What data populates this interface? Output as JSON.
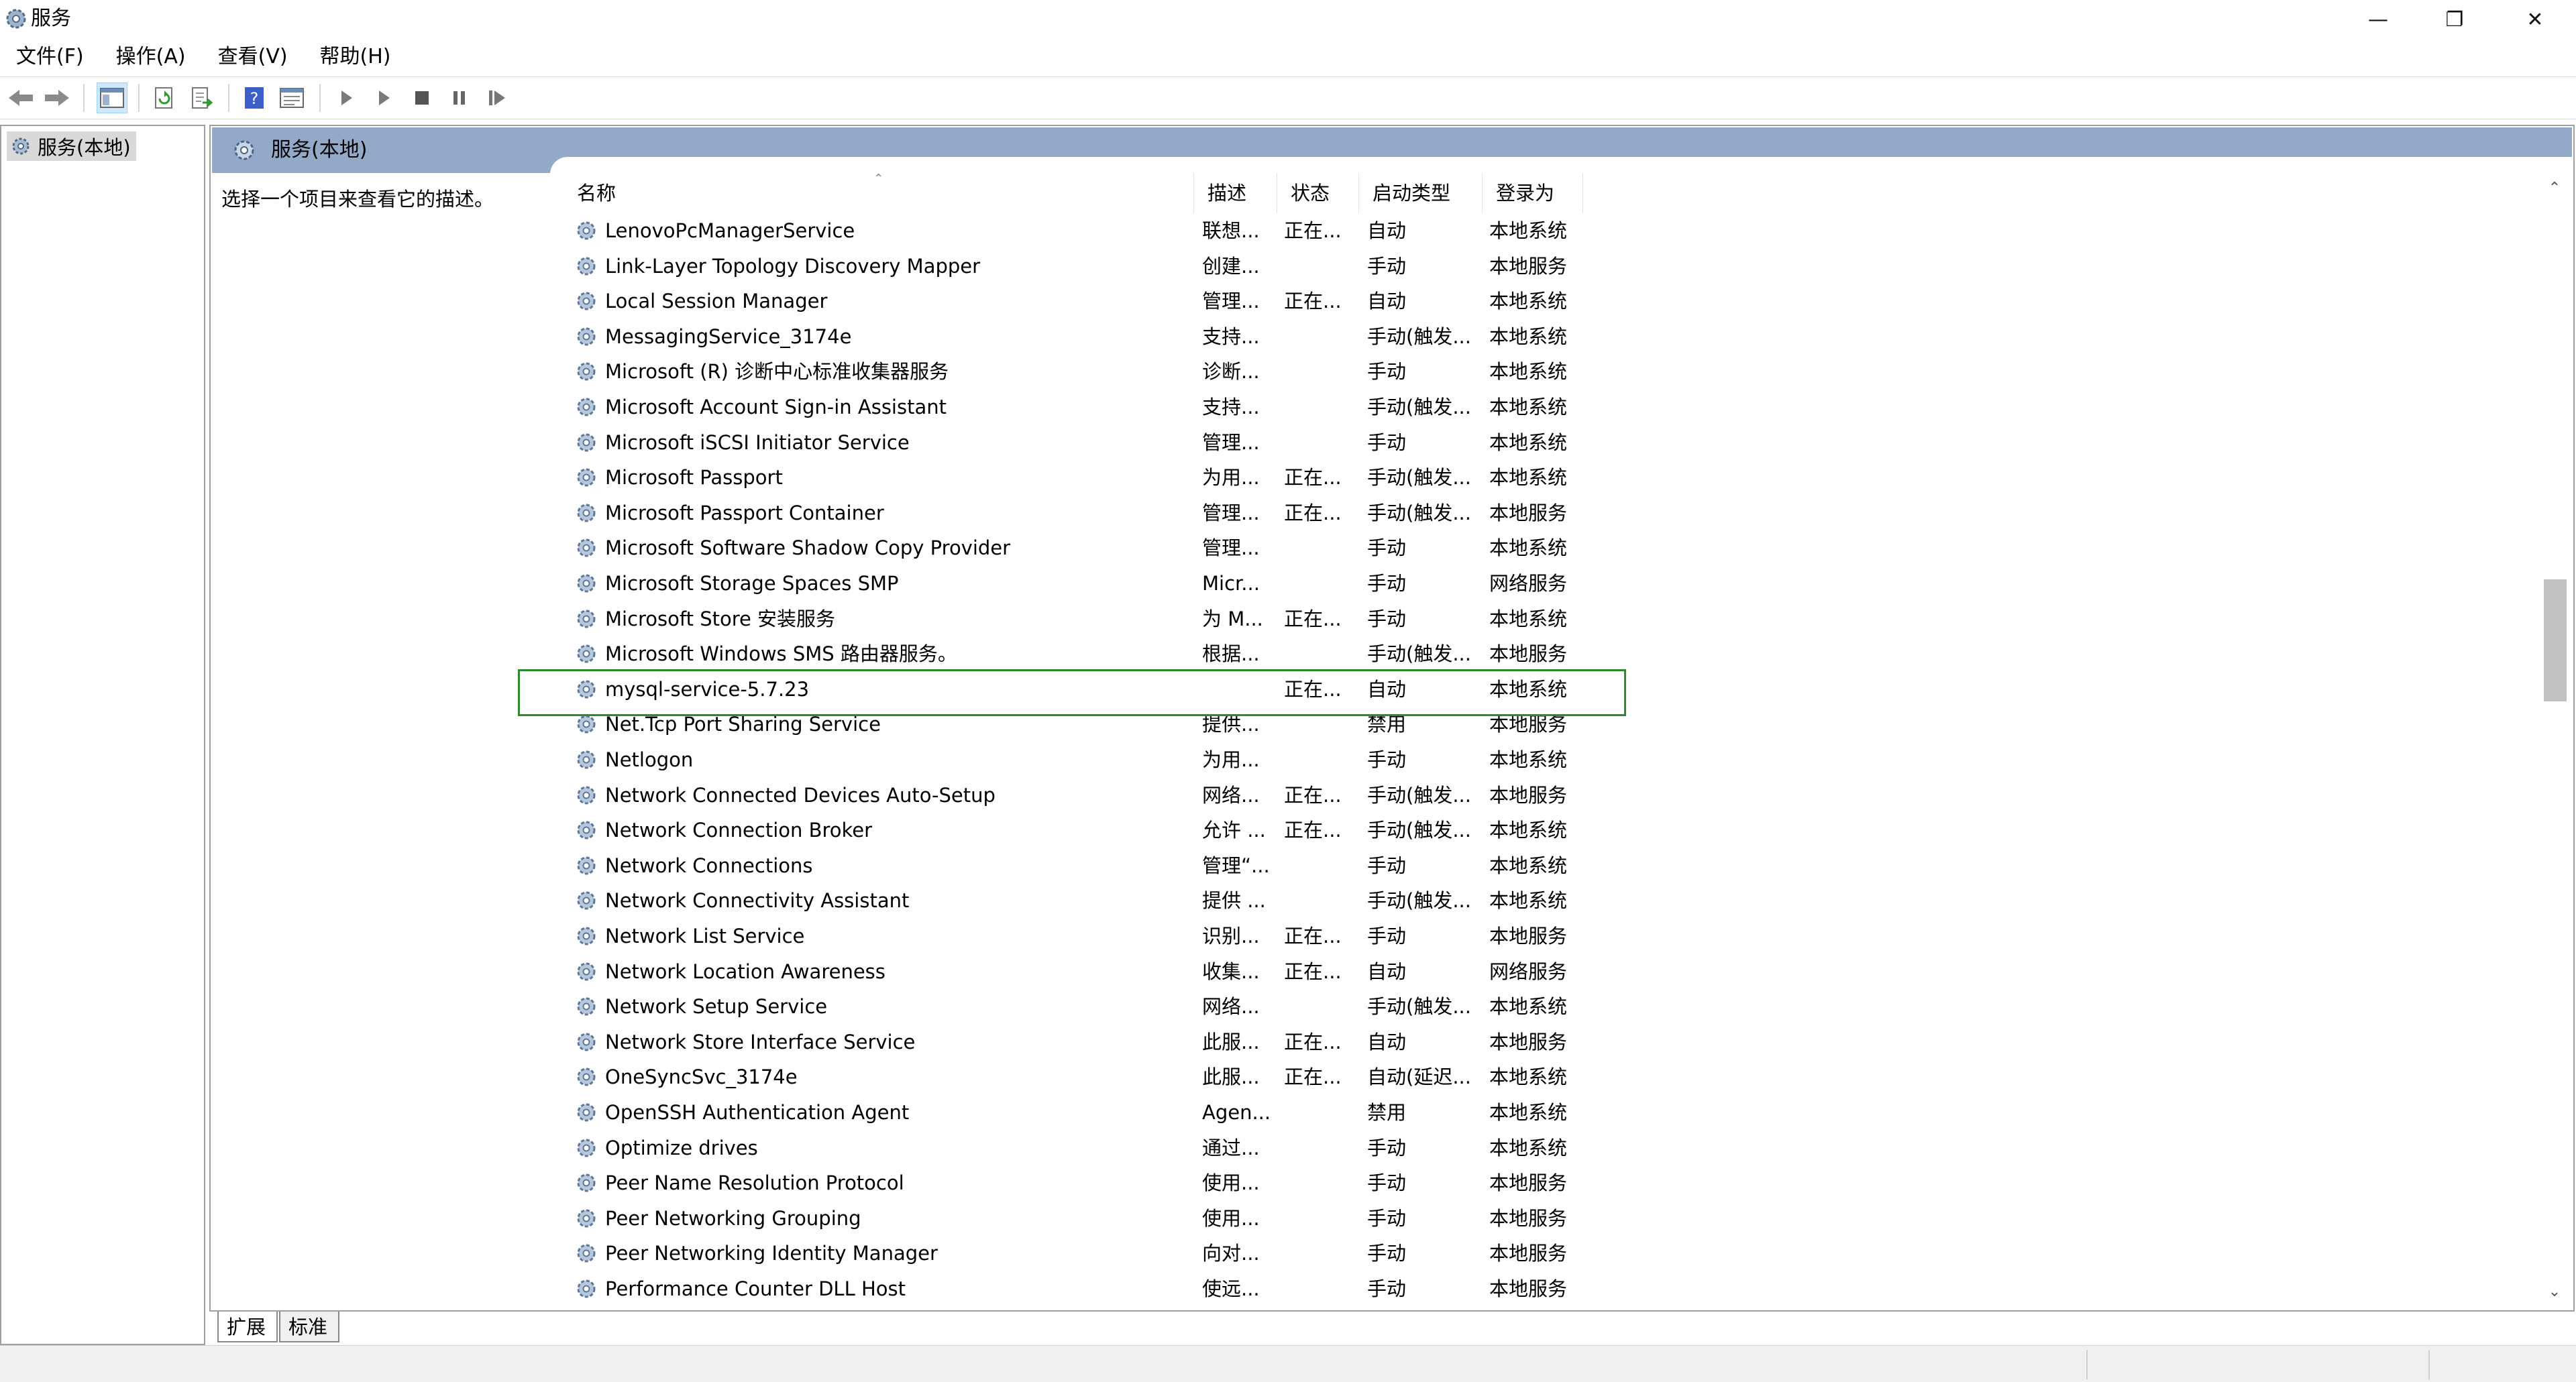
{
  "window": {
    "title": "服务",
    "minimize_icon": "minimize-icon",
    "restore_icon": "restore-icon",
    "close_icon": "close-icon"
  },
  "menu": [
    {
      "label": "文件(F)"
    },
    {
      "label": "操作(A)"
    },
    {
      "label": "查看(V)"
    },
    {
      "label": "帮助(H)"
    }
  ],
  "toolbar": {
    "icons": [
      "back-icon",
      "forward-icon",
      "show-hide-console-tree-icon",
      "refresh-icon",
      "export-list-icon",
      "help-icon",
      "properties-icon",
      "start-service-icon",
      "start-service-alt-icon",
      "stop-service-icon",
      "pause-service-icon",
      "restart-service-icon"
    ]
  },
  "tree": {
    "root_label": "服务(本地)"
  },
  "panel": {
    "header_title": "服务(本地)",
    "description_hint": "选择一个项目来查看它的描述。"
  },
  "columns": {
    "name": "名称",
    "description": "描述",
    "status": "状态",
    "startup_type": "启动类型",
    "logon_as": "登录为"
  },
  "services": [
    {
      "name": "LenovoPcManagerService",
      "description": "联想...",
      "status": "正在...",
      "startup": "自动",
      "logon": "本地系统"
    },
    {
      "name": "Link-Layer Topology Discovery Mapper",
      "description": "创建...",
      "status": "",
      "startup": "手动",
      "logon": "本地服务"
    },
    {
      "name": "Local Session Manager",
      "description": "管理...",
      "status": "正在...",
      "startup": "自动",
      "logon": "本地系统"
    },
    {
      "name": "MessagingService_3174e",
      "description": "支持...",
      "status": "",
      "startup": "手动(触发...",
      "logon": "本地系统"
    },
    {
      "name": "Microsoft (R) 诊断中心标准收集器服务",
      "description": "诊断...",
      "status": "",
      "startup": "手动",
      "logon": "本地系统"
    },
    {
      "name": "Microsoft Account Sign-in Assistant",
      "description": "支持...",
      "status": "",
      "startup": "手动(触发...",
      "logon": "本地系统"
    },
    {
      "name": "Microsoft iSCSI Initiator Service",
      "description": "管理...",
      "status": "",
      "startup": "手动",
      "logon": "本地系统"
    },
    {
      "name": "Microsoft Passport",
      "description": "为用...",
      "status": "正在...",
      "startup": "手动(触发...",
      "logon": "本地系统"
    },
    {
      "name": "Microsoft Passport Container",
      "description": "管理...",
      "status": "正在...",
      "startup": "手动(触发...",
      "logon": "本地服务"
    },
    {
      "name": "Microsoft Software Shadow Copy Provider",
      "description": "管理...",
      "status": "",
      "startup": "手动",
      "logon": "本地系统"
    },
    {
      "name": "Microsoft Storage Spaces SMP",
      "description": "Micr...",
      "status": "",
      "startup": "手动",
      "logon": "网络服务"
    },
    {
      "name": "Microsoft Store 安装服务",
      "description": "为 M...",
      "status": "正在...",
      "startup": "手动",
      "logon": "本地系统"
    },
    {
      "name": "Microsoft Windows SMS 路由器服务。",
      "description": "根据...",
      "status": "",
      "startup": "手动(触发...",
      "logon": "本地服务"
    },
    {
      "name": "mysql-service-5.7.23",
      "description": "",
      "status": "正在...",
      "startup": "自动",
      "logon": "本地系统"
    },
    {
      "name": "Net.Tcp Port Sharing Service",
      "description": "提供...",
      "status": "",
      "startup": "禁用",
      "logon": "本地服务"
    },
    {
      "name": "Netlogon",
      "description": "为用...",
      "status": "",
      "startup": "手动",
      "logon": "本地系统"
    },
    {
      "name": "Network Connected Devices Auto-Setup",
      "description": "网络...",
      "status": "正在...",
      "startup": "手动(触发...",
      "logon": "本地服务"
    },
    {
      "name": "Network Connection Broker",
      "description": "允许 ...",
      "status": "正在...",
      "startup": "手动(触发...",
      "logon": "本地系统"
    },
    {
      "name": "Network Connections",
      "description": "管理“...",
      "status": "",
      "startup": "手动",
      "logon": "本地系统"
    },
    {
      "name": "Network Connectivity Assistant",
      "description": "提供 ...",
      "status": "",
      "startup": "手动(触发...",
      "logon": "本地系统"
    },
    {
      "name": "Network List Service",
      "description": "识别...",
      "status": "正在...",
      "startup": "手动",
      "logon": "本地服务"
    },
    {
      "name": "Network Location Awareness",
      "description": "收集...",
      "status": "正在...",
      "startup": "自动",
      "logon": "网络服务"
    },
    {
      "name": "Network Setup Service",
      "description": "网络...",
      "status": "",
      "startup": "手动(触发...",
      "logon": "本地系统"
    },
    {
      "name": "Network Store Interface Service",
      "description": "此服...",
      "status": "正在...",
      "startup": "自动",
      "logon": "本地服务"
    },
    {
      "name": "OneSyncSvc_3174e",
      "description": "此服...",
      "status": "正在...",
      "startup": "自动(延迟...",
      "logon": "本地系统"
    },
    {
      "name": "OpenSSH Authentication Agent",
      "description": "Agen...",
      "status": "",
      "startup": "禁用",
      "logon": "本地系统"
    },
    {
      "name": "Optimize drives",
      "description": "通过...",
      "status": "",
      "startup": "手动",
      "logon": "本地系统"
    },
    {
      "name": "Peer Name Resolution Protocol",
      "description": "使用...",
      "status": "",
      "startup": "手动",
      "logon": "本地服务"
    },
    {
      "name": "Peer Networking Grouping",
      "description": "使用...",
      "status": "",
      "startup": "手动",
      "logon": "本地服务"
    },
    {
      "name": "Peer Networking Identity Manager",
      "description": "向对...",
      "status": "",
      "startup": "手动",
      "logon": "本地服务"
    },
    {
      "name": "Performance Counter DLL Host",
      "description": "使远...",
      "status": "",
      "startup": "手动",
      "logon": "本地服务"
    }
  ],
  "tabs": [
    {
      "label": "扩展"
    },
    {
      "label": "标准"
    }
  ],
  "colors": {
    "header_bg": "#92a9c8",
    "selection_border": "#2f8a2f",
    "tree_selected_bg": "#d9d9d9"
  }
}
